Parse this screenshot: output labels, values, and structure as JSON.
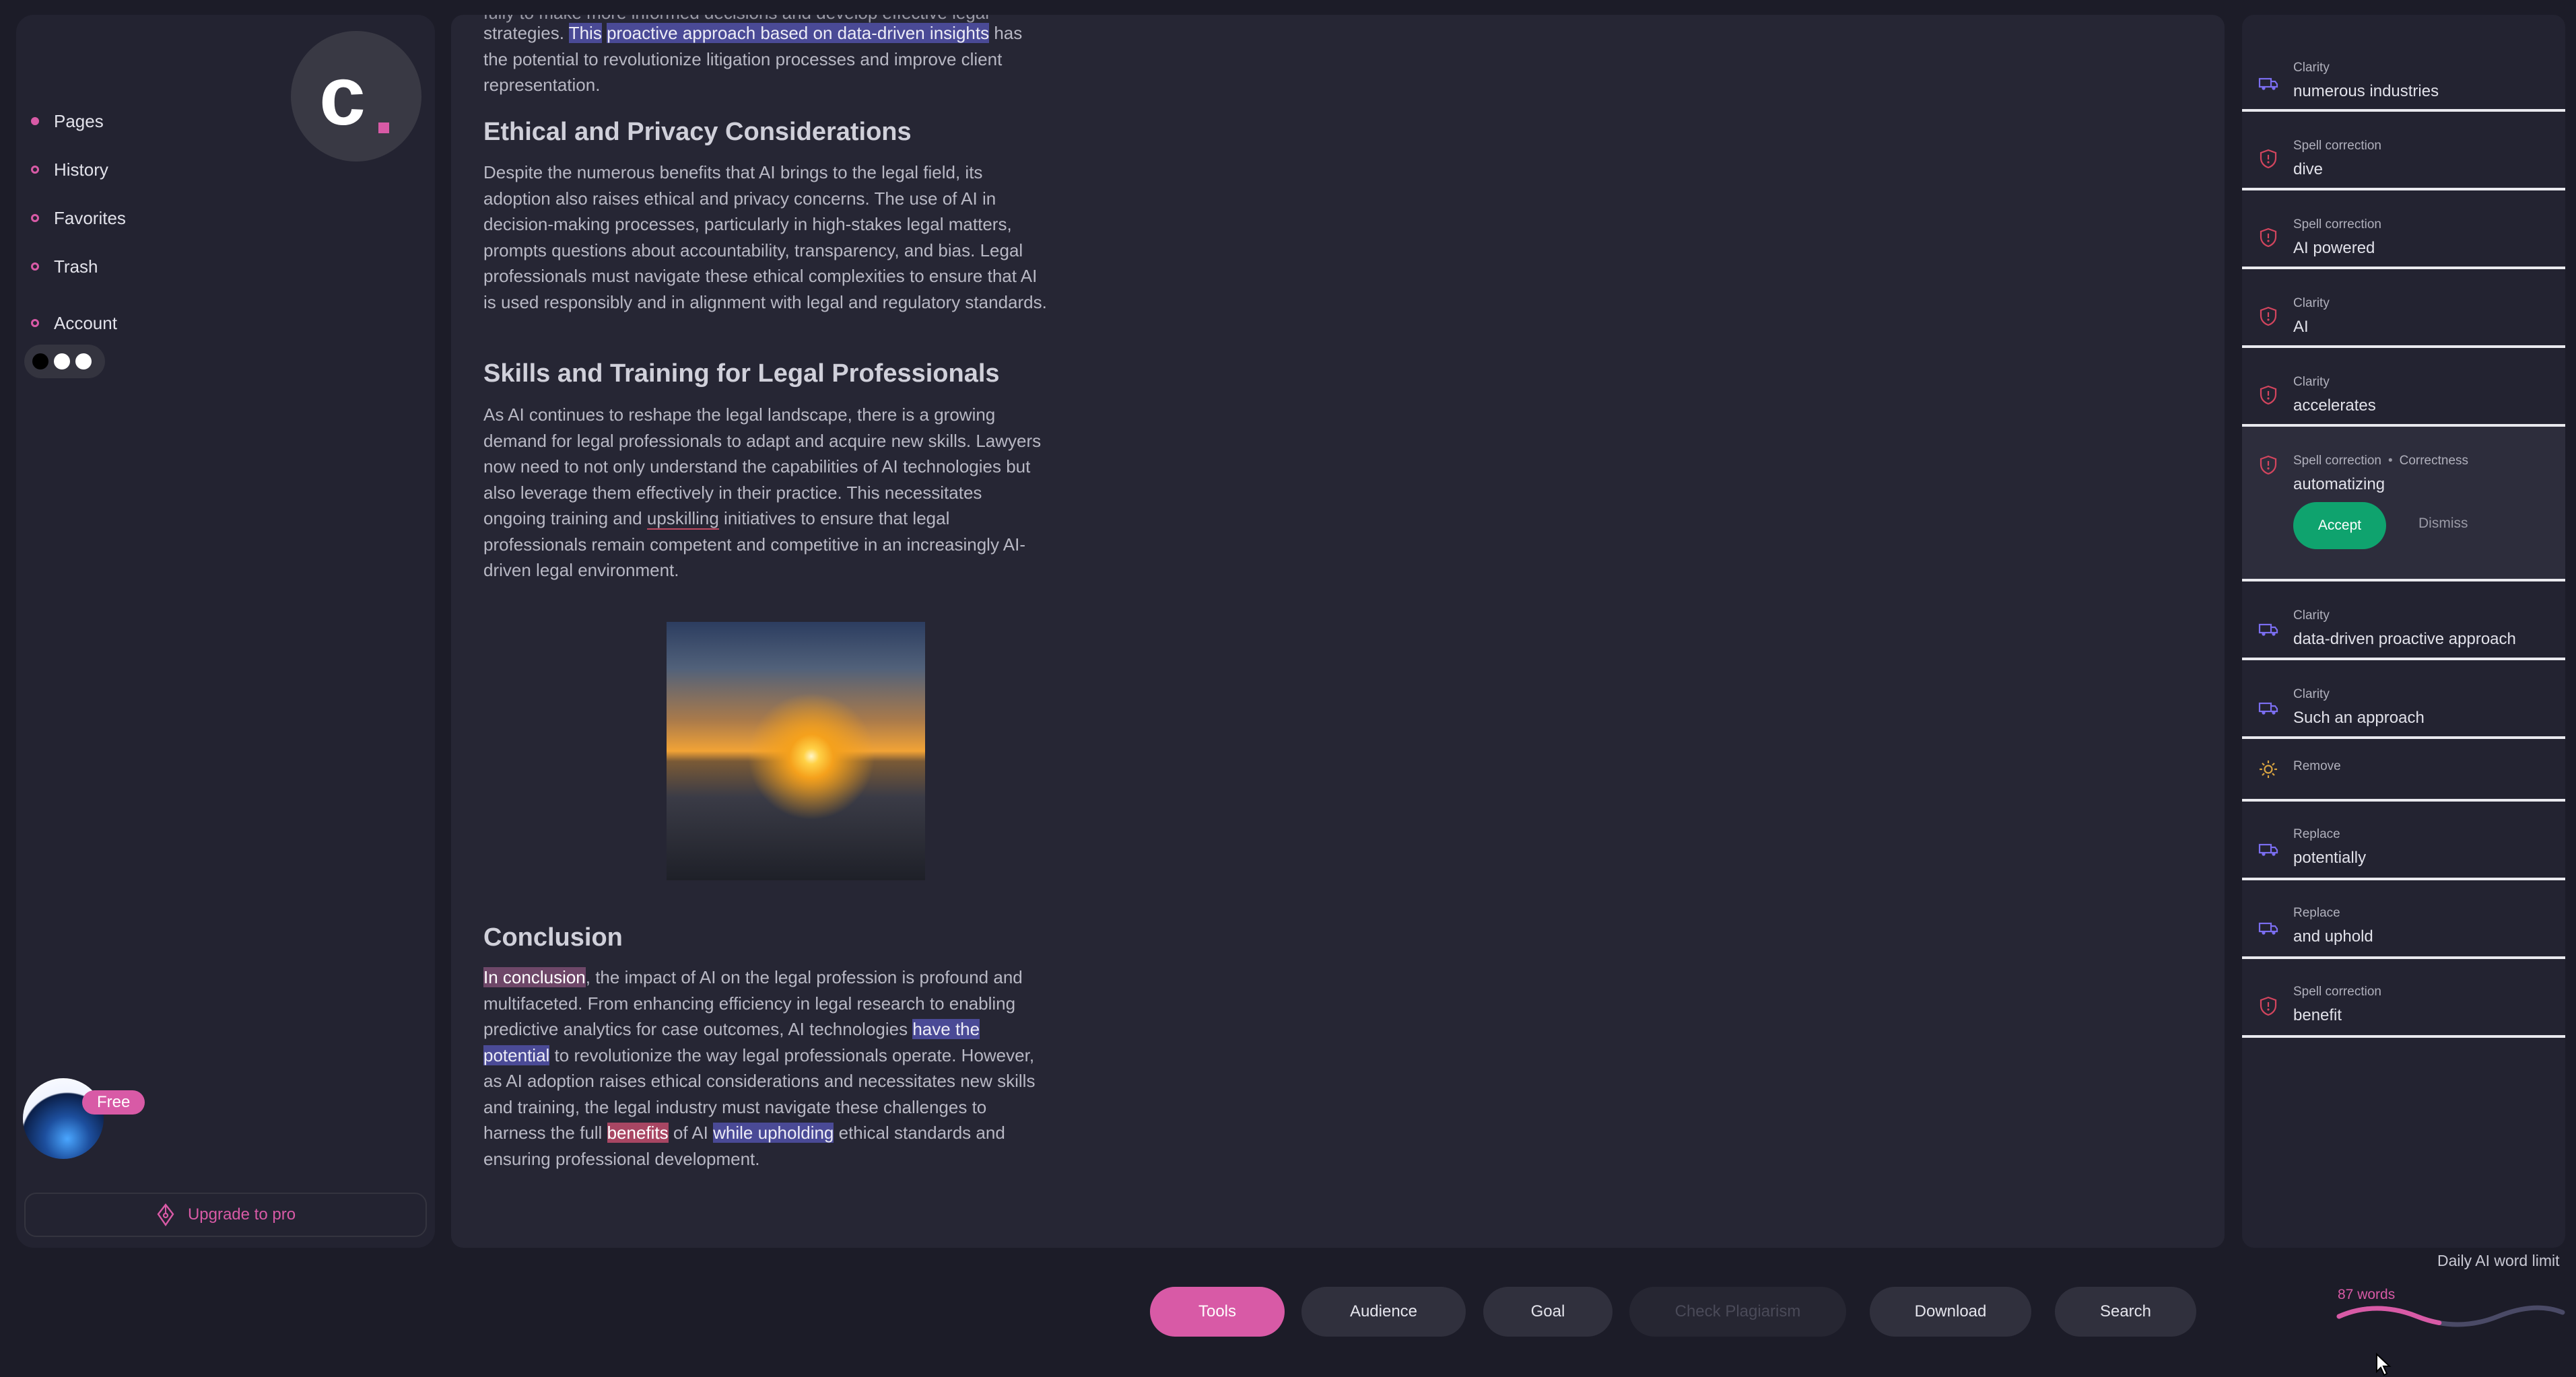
{
  "sidebar": {
    "logo_letter": "c",
    "nav": [
      {
        "label": "Pages",
        "active": true
      },
      {
        "label": "History",
        "active": false
      },
      {
        "label": "Favorites",
        "active": false
      },
      {
        "label": "Trash",
        "active": false
      },
      {
        "label": "Account",
        "active": false
      }
    ],
    "plan_badge": "Free",
    "upgrade_label": "Upgrade to pro"
  },
  "document": {
    "top_line": "fully to make more informed decisions and develop effective legal",
    "intro": {
      "pre": "strategies. ",
      "hl1": "This",
      "sp": " ",
      "hl2": "proactive approach based on data-driven insights",
      "post": "has the potential to revolutionize litigation processes and improve client representation."
    },
    "section1": {
      "heading": "Ethical and Privacy Considerations",
      "body": "Despite the numerous benefits that AI brings to the legal field, its adoption also raises ethical and privacy concerns. The use of AI in decision-making processes, particularly in high-stakes legal matters, prompts questions about accountability, transparency, and bias. Legal professionals must navigate these ethical complexities to ensure that AI is used responsibly and in alignment with legal and regulatory standards."
    },
    "section2": {
      "heading": "Skills and Training for Legal Professionals",
      "body_a": "As AI continues to reshape the legal landscape, there is a growing demand for legal professionals to adapt and acquire new skills. Lawyers now need to not only understand the capabilities of AI technologies but also leverage them effectively in their practice. This necessitates ongoing training and ",
      "body_underlined": "upskilling",
      "body_b": " initiatives to ensure that legal professionals remain competent and competitive in an increasingly AI-driven legal environment."
    },
    "conclusion": {
      "heading": "Conclusion",
      "p1_hl": "In conclusion",
      "p1": ", the impact of AI on the legal profession is profound and multifaceted. From enhancing efficiency in legal research to enabling predictive analytics for case outcomes, AI technologies ",
      "p2_hl": "have the potential",
      "p2": " to revolutionize the way legal professionals operate. However, as AI adoption raises ethical considerations and necessitates new skills and training, the legal industry must navigate these challenges to harness the full ",
      "p3_hl": "benefits",
      "p3": " of AI ",
      "p4_hl": "while upholding",
      "p4": " ethical standards and ensuring professional development."
    }
  },
  "suggestions": [
    {
      "category": "Clarity",
      "value": "numerous industries",
      "icon": "truck-icon"
    },
    {
      "category": "Spell correction",
      "value": "dive",
      "icon": "shield-icon"
    },
    {
      "category": "Spell correction",
      "value": "AI powered",
      "icon": "shield-icon"
    },
    {
      "category": "Clarity",
      "value": "AI",
      "icon": "shield-icon"
    },
    {
      "category": "Clarity",
      "value": "accelerates",
      "icon": "shield-icon"
    },
    {
      "category": "Spell correction",
      "category2": "Correctness",
      "value": "automatizing",
      "icon": "shield-icon",
      "accept": "Accept",
      "dismiss": "Dismiss"
    },
    {
      "category": "Clarity",
      "value": "data-driven proactive approach",
      "icon": "truck-icon"
    },
    {
      "category": "Clarity",
      "value": "Such an approach",
      "icon": "truck-icon"
    },
    {
      "category": "Remove",
      "value": "",
      "icon": "sun-icon"
    },
    {
      "category": "Replace",
      "value": "potentially",
      "icon": "truck-icon"
    },
    {
      "category": "Replace",
      "value": "and uphold",
      "icon": "truck-icon"
    },
    {
      "category": "Spell correction",
      "value": "benefit",
      "icon": "shield-icon"
    }
  ],
  "toolbar": {
    "tools": "Tools",
    "audience": "Audience",
    "goal": "Goal",
    "check_plagiarism": "Check Plagiarism",
    "download": "Download",
    "search": "Search"
  },
  "ai_limit": {
    "label": "Daily AI word limit",
    "words": "87 words",
    "used_fraction": 0.45
  },
  "colors": {
    "accent": "#d85aa6",
    "accept": "#0fa36e",
    "highlight_blue": "#4a4a96",
    "highlight_red": "#a84663"
  }
}
